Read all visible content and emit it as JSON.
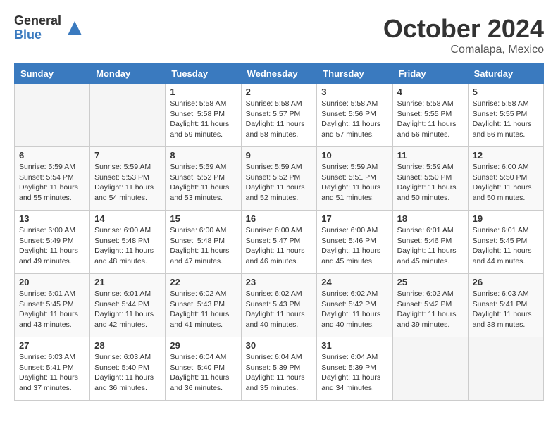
{
  "header": {
    "logo_general": "General",
    "logo_blue": "Blue",
    "month": "October 2024",
    "location": "Comalapa, Mexico"
  },
  "weekdays": [
    "Sunday",
    "Monday",
    "Tuesday",
    "Wednesday",
    "Thursday",
    "Friday",
    "Saturday"
  ],
  "weeks": [
    [
      {
        "day": "",
        "info": ""
      },
      {
        "day": "",
        "info": ""
      },
      {
        "day": "1",
        "info": "Sunrise: 5:58 AM\nSunset: 5:58 PM\nDaylight: 11 hours and 59 minutes."
      },
      {
        "day": "2",
        "info": "Sunrise: 5:58 AM\nSunset: 5:57 PM\nDaylight: 11 hours and 58 minutes."
      },
      {
        "day": "3",
        "info": "Sunrise: 5:58 AM\nSunset: 5:56 PM\nDaylight: 11 hours and 57 minutes."
      },
      {
        "day": "4",
        "info": "Sunrise: 5:58 AM\nSunset: 5:55 PM\nDaylight: 11 hours and 56 minutes."
      },
      {
        "day": "5",
        "info": "Sunrise: 5:58 AM\nSunset: 5:55 PM\nDaylight: 11 hours and 56 minutes."
      }
    ],
    [
      {
        "day": "6",
        "info": "Sunrise: 5:59 AM\nSunset: 5:54 PM\nDaylight: 11 hours and 55 minutes."
      },
      {
        "day": "7",
        "info": "Sunrise: 5:59 AM\nSunset: 5:53 PM\nDaylight: 11 hours and 54 minutes."
      },
      {
        "day": "8",
        "info": "Sunrise: 5:59 AM\nSunset: 5:52 PM\nDaylight: 11 hours and 53 minutes."
      },
      {
        "day": "9",
        "info": "Sunrise: 5:59 AM\nSunset: 5:52 PM\nDaylight: 11 hours and 52 minutes."
      },
      {
        "day": "10",
        "info": "Sunrise: 5:59 AM\nSunset: 5:51 PM\nDaylight: 11 hours and 51 minutes."
      },
      {
        "day": "11",
        "info": "Sunrise: 5:59 AM\nSunset: 5:50 PM\nDaylight: 11 hours and 50 minutes."
      },
      {
        "day": "12",
        "info": "Sunrise: 6:00 AM\nSunset: 5:50 PM\nDaylight: 11 hours and 50 minutes."
      }
    ],
    [
      {
        "day": "13",
        "info": "Sunrise: 6:00 AM\nSunset: 5:49 PM\nDaylight: 11 hours and 49 minutes."
      },
      {
        "day": "14",
        "info": "Sunrise: 6:00 AM\nSunset: 5:48 PM\nDaylight: 11 hours and 48 minutes."
      },
      {
        "day": "15",
        "info": "Sunrise: 6:00 AM\nSunset: 5:48 PM\nDaylight: 11 hours and 47 minutes."
      },
      {
        "day": "16",
        "info": "Sunrise: 6:00 AM\nSunset: 5:47 PM\nDaylight: 11 hours and 46 minutes."
      },
      {
        "day": "17",
        "info": "Sunrise: 6:00 AM\nSunset: 5:46 PM\nDaylight: 11 hours and 45 minutes."
      },
      {
        "day": "18",
        "info": "Sunrise: 6:01 AM\nSunset: 5:46 PM\nDaylight: 11 hours and 45 minutes."
      },
      {
        "day": "19",
        "info": "Sunrise: 6:01 AM\nSunset: 5:45 PM\nDaylight: 11 hours and 44 minutes."
      }
    ],
    [
      {
        "day": "20",
        "info": "Sunrise: 6:01 AM\nSunset: 5:45 PM\nDaylight: 11 hours and 43 minutes."
      },
      {
        "day": "21",
        "info": "Sunrise: 6:01 AM\nSunset: 5:44 PM\nDaylight: 11 hours and 42 minutes."
      },
      {
        "day": "22",
        "info": "Sunrise: 6:02 AM\nSunset: 5:43 PM\nDaylight: 11 hours and 41 minutes."
      },
      {
        "day": "23",
        "info": "Sunrise: 6:02 AM\nSunset: 5:43 PM\nDaylight: 11 hours and 40 minutes."
      },
      {
        "day": "24",
        "info": "Sunrise: 6:02 AM\nSunset: 5:42 PM\nDaylight: 11 hours and 40 minutes."
      },
      {
        "day": "25",
        "info": "Sunrise: 6:02 AM\nSunset: 5:42 PM\nDaylight: 11 hours and 39 minutes."
      },
      {
        "day": "26",
        "info": "Sunrise: 6:03 AM\nSunset: 5:41 PM\nDaylight: 11 hours and 38 minutes."
      }
    ],
    [
      {
        "day": "27",
        "info": "Sunrise: 6:03 AM\nSunset: 5:41 PM\nDaylight: 11 hours and 37 minutes."
      },
      {
        "day": "28",
        "info": "Sunrise: 6:03 AM\nSunset: 5:40 PM\nDaylight: 11 hours and 36 minutes."
      },
      {
        "day": "29",
        "info": "Sunrise: 6:04 AM\nSunset: 5:40 PM\nDaylight: 11 hours and 36 minutes."
      },
      {
        "day": "30",
        "info": "Sunrise: 6:04 AM\nSunset: 5:39 PM\nDaylight: 11 hours and 35 minutes."
      },
      {
        "day": "31",
        "info": "Sunrise: 6:04 AM\nSunset: 5:39 PM\nDaylight: 11 hours and 34 minutes."
      },
      {
        "day": "",
        "info": ""
      },
      {
        "day": "",
        "info": ""
      }
    ]
  ]
}
